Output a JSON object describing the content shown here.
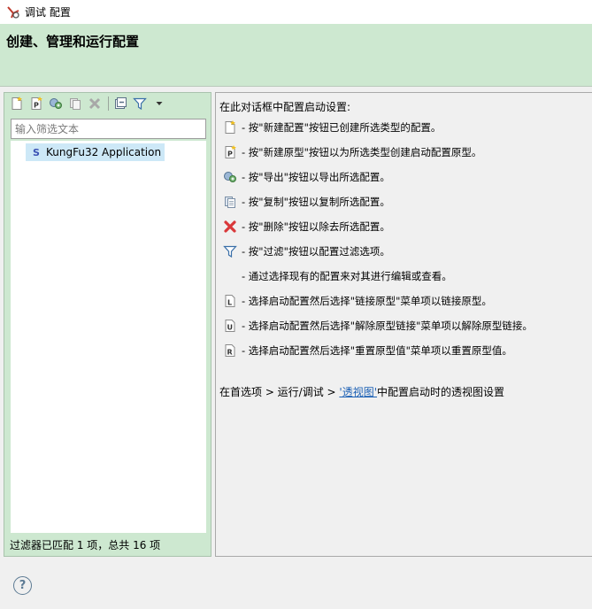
{
  "window": {
    "title": "调试 配置"
  },
  "header": {
    "title": "创建、管理和运行配置"
  },
  "toolbar": {
    "items": [
      {
        "name": "new-config-icon"
      },
      {
        "name": "new-prototype-icon"
      },
      {
        "name": "export-icon"
      },
      {
        "name": "duplicate-icon"
      },
      {
        "name": "delete-icon"
      },
      {
        "name": "collapse-all-icon"
      },
      {
        "name": "filter-icon"
      },
      {
        "name": "dropdown-arrow-icon"
      }
    ]
  },
  "filter": {
    "placeholder": "输入筛选文本"
  },
  "tree": {
    "items": [
      {
        "icon": "S",
        "label": "KungFu32 Application"
      }
    ]
  },
  "status": {
    "text": "过滤器已匹配 1 项，总共 16 项"
  },
  "right": {
    "intro": "在此对话框中配置启动设置:",
    "rows": [
      {
        "icon": "new-config-icon",
        "text": "- 按\"新建配置\"按钮已创建所选类型的配置。"
      },
      {
        "icon": "new-prototype-icon",
        "text": "- 按\"新建原型\"按钮以为所选类型创建启动配置原型。"
      },
      {
        "icon": "export-icon",
        "text": "- 按\"导出\"按钮以导出所选配置。"
      },
      {
        "icon": "duplicate-icon",
        "text": "- 按\"复制\"按钮以复制所选配置。"
      },
      {
        "icon": "delete-icon",
        "text": "- 按\"删除\"按钮以除去所选配置。"
      },
      {
        "icon": "filter-icon",
        "text": "- 按\"过滤\"按钮以配置过滤选项。"
      },
      {
        "icon": "",
        "text": "- 通过选择现有的配置来对其进行编辑或查看。"
      },
      {
        "icon": "link-prototype-icon",
        "text": "- 选择启动配置然后选择\"链接原型\"菜单项以链接原型。"
      },
      {
        "icon": "unlink-prototype-icon",
        "text": "- 选择启动配置然后选择\"解除原型链接\"菜单项以解除原型链接。"
      },
      {
        "icon": "reset-prototype-icon",
        "text": "- 选择启动配置然后选择\"重置原型值\"菜单项以重置原型值。"
      }
    ],
    "pref_prefix": "在首选项 > 运行/调试 > ",
    "pref_link": "'透视图'",
    "pref_suffix": "中配置启动时的透视图设置"
  },
  "help": {
    "glyph": "?"
  },
  "colors": {
    "header_bg": "#cde8d0",
    "link": "#1a5fb4",
    "selection": "#cde8f7",
    "delete": "#d9383a"
  }
}
